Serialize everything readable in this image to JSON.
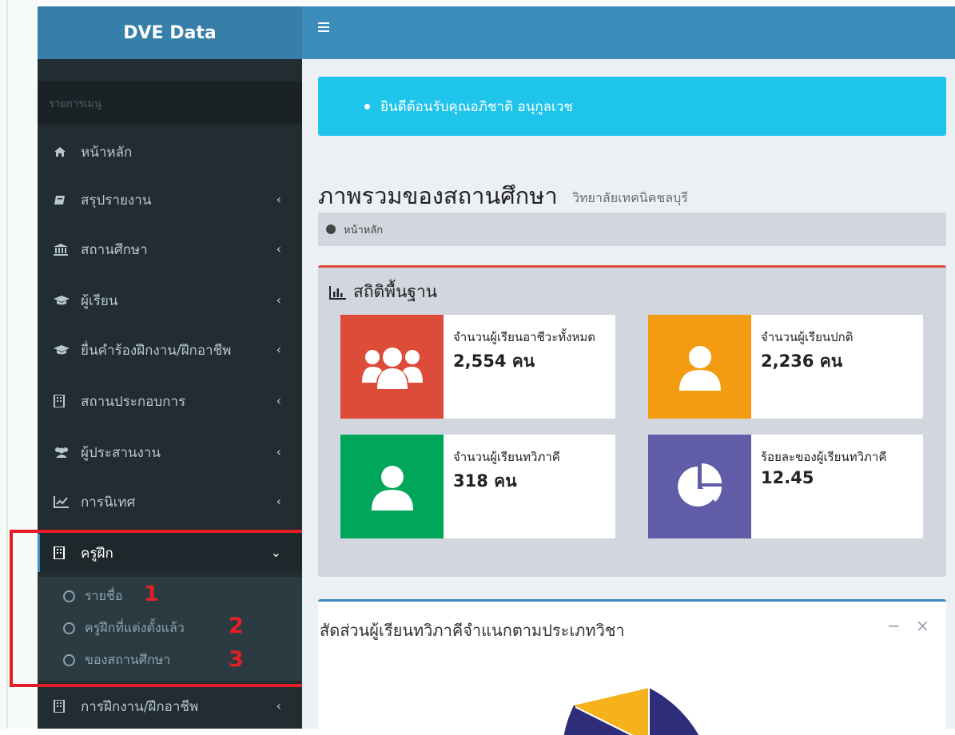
{
  "app": {
    "title": "DVE Data"
  },
  "sidebar": {
    "header": "รายการเมนู",
    "items": [
      {
        "label": "หน้าหลัก",
        "icon": "home-icon"
      },
      {
        "label": "สรุปรายงาน",
        "icon": "book-icon",
        "caret": "‹"
      },
      {
        "label": "สถานศึกษา",
        "icon": "institution-icon",
        "caret": "‹"
      },
      {
        "label": "ผู้เรียน",
        "icon": "graduation-cap-icon",
        "caret": "‹"
      },
      {
        "label": "ยื่นคำร้องฝึกงาน/ฝึกอาชีพ",
        "icon": "graduation-cap-icon",
        "caret": "‹"
      },
      {
        "label": "สถานประกอบการ",
        "icon": "building-icon",
        "caret": "‹"
      },
      {
        "label": "ผู้ประสานงาน",
        "icon": "users-icon",
        "caret": "‹"
      },
      {
        "label": "การนิเทศ",
        "icon": "line-chart-icon",
        "caret": "‹"
      },
      {
        "label": "ครูฝึก",
        "icon": "building-icon",
        "caret": "⌄"
      },
      {
        "label": "การฝึกงาน/ฝึกอาชีพ",
        "icon": "building-icon",
        "caret": "‹"
      }
    ],
    "submenu": [
      {
        "label": "รายชื่อ",
        "number": "1"
      },
      {
        "label": "ครูฝึกที่แต่งตั้งแล้ว",
        "number": "2"
      },
      {
        "label": "ของสถานศึกษา",
        "number": "3"
      }
    ]
  },
  "callout": {
    "text": "ยินดีต้อนรับคุณอภิชาติ อนุกูลเวช"
  },
  "page": {
    "title": "ภาพรวมของสถานศึกษา",
    "subtitle": "วิทยาลัยเทคนิคชลบุรี",
    "breadcrumb": "หน้าหลัก"
  },
  "stats": {
    "title": "สถิติพื้นฐาน",
    "boxes": [
      {
        "label": "จำนวนผู้เรียนอาชีวะทั้งหมด",
        "value": "2,554 คน",
        "color": "#dd4b39",
        "icon": "users-icon"
      },
      {
        "label": "จำนวนผู้เรียนปกติ",
        "value": "2,236 คน",
        "color": "#f39c12",
        "icon": "user-icon"
      },
      {
        "label": "จำนวนผู้เรียนทวิภาคี",
        "value": "318 คน",
        "color": "#00a65a",
        "icon": "user-icon"
      },
      {
        "label": "ร้อยละของผู้เรียนทวิภาคี",
        "value": "12.45",
        "color": "#605ca8",
        "icon": "pie-chart-icon"
      }
    ]
  },
  "chart_box": {
    "title": "สัดส่วนผู้เรียนทวิภาคีจำแนกตามประเภทวิชา",
    "minimize": "−",
    "close": "×"
  },
  "colors": {
    "topbar": "#3c8dbc",
    "logo": "#367fa9",
    "sidebar": "#222d32",
    "annotation": "#e41e26"
  }
}
